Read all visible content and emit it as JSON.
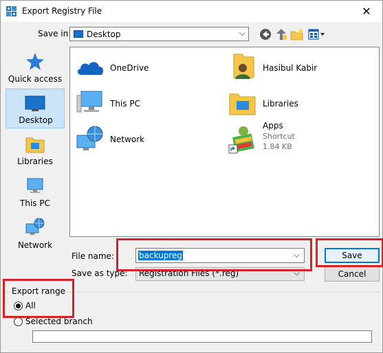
{
  "window": {
    "title": "Export Registry File",
    "close_glyph": "✕"
  },
  "toolbar": {
    "save_in_label": "Save in:",
    "save_in_value": "Desktop",
    "icons": [
      "back-icon",
      "up-folder-icon",
      "new-folder-icon",
      "view-menu-icon"
    ]
  },
  "places": [
    {
      "label": "Quick access",
      "icon": "star-icon"
    },
    {
      "label": "Desktop",
      "icon": "desktop-icon",
      "selected": true
    },
    {
      "label": "Libraries",
      "icon": "libraries-icon"
    },
    {
      "label": "This PC",
      "icon": "pc-icon"
    },
    {
      "label": "Network",
      "icon": "network-icon"
    }
  ],
  "files": [
    {
      "name": "OneDrive",
      "icon": "onedrive-icon"
    },
    {
      "name": "Hasibul Kabir",
      "icon": "user-folder-icon"
    },
    {
      "name": "This PC",
      "icon": "pc-icon"
    },
    {
      "name": "Libraries",
      "icon": "libraries-icon"
    },
    {
      "name": "Network",
      "icon": "network-icon"
    },
    {
      "name": "Apps",
      "icon": "bluestacks-shortcut-icon",
      "type": "Shortcut",
      "size": "1.84 KB"
    }
  ],
  "fields": {
    "file_name_label": "File name:",
    "file_name_value": "backupreg",
    "save_type_label": "Save as type:",
    "save_type_value": "Registration Files (*.reg)"
  },
  "buttons": {
    "save": "Save",
    "cancel": "Cancel"
  },
  "export_range": {
    "label": "Export range",
    "all_label": "All",
    "selected_branch_label": "Selected branch",
    "selected": "All",
    "branch_value": ""
  },
  "colors": {
    "annotation_red": "#d9212a",
    "selection_blue": "#0078d7"
  }
}
